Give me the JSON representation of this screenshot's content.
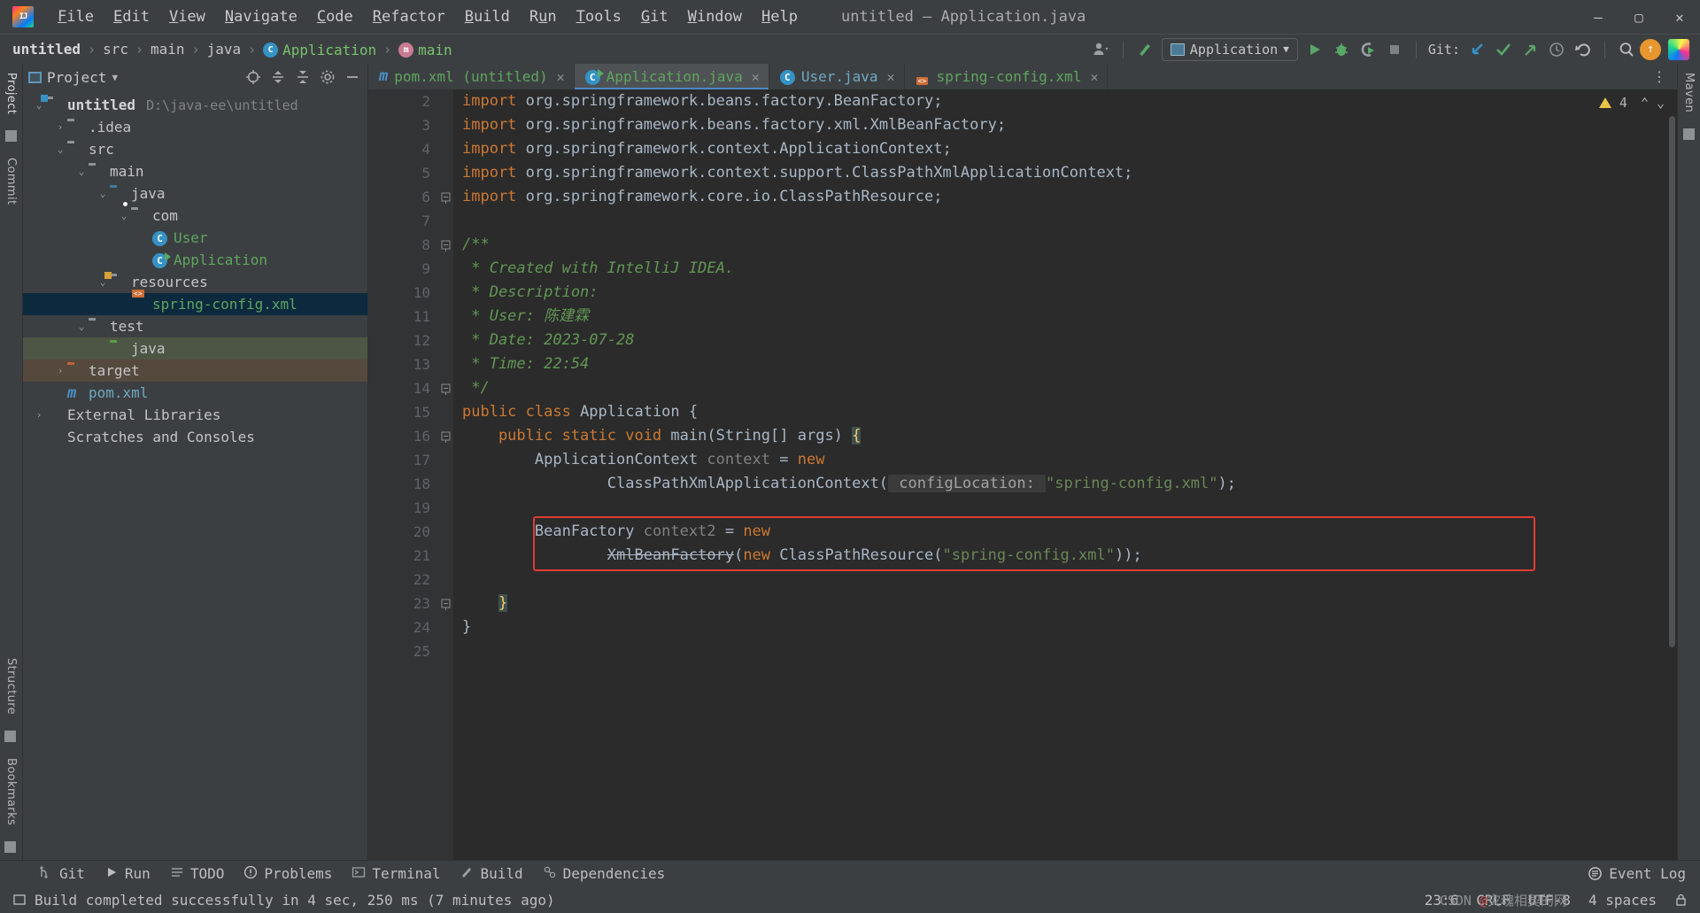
{
  "window": {
    "title": "untitled – Application.java",
    "logo_text": "IJ",
    "minimize": "—",
    "maximize": "▢",
    "close": "✕"
  },
  "menubar": [
    {
      "pre": "",
      "mn": "F",
      "post": "ile"
    },
    {
      "pre": "",
      "mn": "E",
      "post": "dit"
    },
    {
      "pre": "",
      "mn": "V",
      "post": "iew"
    },
    {
      "pre": "",
      "mn": "N",
      "post": "avigate"
    },
    {
      "pre": "",
      "mn": "C",
      "post": "ode"
    },
    {
      "pre": "",
      "mn": "R",
      "post": "efactor"
    },
    {
      "pre": "",
      "mn": "B",
      "post": "uild"
    },
    {
      "pre": "R",
      "mn": "u",
      "post": "n"
    },
    {
      "pre": "",
      "mn": "T",
      "post": "ools"
    },
    {
      "pre": "",
      "mn": "G",
      "post": "it"
    },
    {
      "pre": "",
      "mn": "W",
      "post": "indow"
    },
    {
      "pre": "",
      "mn": "H",
      "post": "elp"
    }
  ],
  "breadcrumb": [
    {
      "label": "untitled",
      "style": "bold"
    },
    {
      "label": "src",
      "style": "plain"
    },
    {
      "label": "main",
      "style": "plain"
    },
    {
      "label": "java",
      "style": "plain"
    },
    {
      "label": "Application",
      "style": "green",
      "icon": "class-icon"
    },
    {
      "label": "main",
      "style": "green",
      "icon": "method-icon"
    }
  ],
  "toolbar": {
    "run_config": "Application",
    "git_label": "Git:",
    "icons": {
      "user_settings": "user-settings-icon",
      "build_hammer": "build-icon",
      "run": "run-icon",
      "debug": "debug-icon",
      "run_coverage": "run-with-coverage-icon",
      "stop": "stop-icon",
      "git_update": "git-update-icon",
      "git_commit": "git-commit-icon",
      "git_push": "git-push-icon",
      "git_history": "history-icon",
      "rollback": "rollback-icon",
      "search_everywhere": "search-icon",
      "updates_badge": "↑",
      "ide_avatar": "ide-avatar-icon"
    }
  },
  "left_rail": [
    "Project",
    "Commit",
    "Structure",
    "Bookmarks"
  ],
  "right_rail": [
    "Maven"
  ],
  "project_panel": {
    "title": "Project",
    "tree": [
      {
        "depth": 0,
        "arrow": "⌄",
        "icon": "module-folder",
        "label": "untitled",
        "style": "bold",
        "path": "D:\\java-ee\\untitled"
      },
      {
        "depth": 1,
        "arrow": "›",
        "icon": "folder",
        "label": ".idea",
        "style": "plain"
      },
      {
        "depth": 1,
        "arrow": "⌄",
        "icon": "folder",
        "label": "src",
        "style": "plain"
      },
      {
        "depth": 2,
        "arrow": "⌄",
        "icon": "folder",
        "label": "main",
        "style": "plain"
      },
      {
        "depth": 3,
        "arrow": "⌄",
        "icon": "folder-source",
        "label": "java",
        "style": "plain"
      },
      {
        "depth": 4,
        "arrow": "⌄",
        "icon": "package",
        "label": "com",
        "style": "plain"
      },
      {
        "depth": 5,
        "arrow": "",
        "icon": "class",
        "label": "User",
        "style": "green"
      },
      {
        "depth": 5,
        "arrow": "",
        "icon": "class-runnable",
        "label": "Application",
        "style": "green"
      },
      {
        "depth": 3,
        "arrow": "⌄",
        "icon": "folder-resources",
        "label": "resources",
        "style": "plain"
      },
      {
        "depth": 4,
        "arrow": "",
        "icon": "xml",
        "label": "spring-config.xml",
        "style": "green",
        "selected": true
      },
      {
        "depth": 2,
        "arrow": "⌄",
        "icon": "folder",
        "label": "test",
        "style": "plain"
      },
      {
        "depth": 3,
        "arrow": "",
        "icon": "folder-test",
        "label": "java",
        "style": "plain",
        "tint": "green"
      },
      {
        "depth": 1,
        "arrow": "›",
        "icon": "folder-excluded",
        "label": "target",
        "style": "plain",
        "tint": "brown"
      },
      {
        "depth": 1,
        "arrow": "",
        "icon": "maven",
        "label": "pom.xml",
        "style": "blue"
      },
      {
        "depth": 0,
        "arrow": "›",
        "icon": "library",
        "label": "External Libraries",
        "style": "plain"
      },
      {
        "depth": 0,
        "arrow": "",
        "icon": "scratch",
        "label": "Scratches and Consoles",
        "style": "plain"
      }
    ]
  },
  "editor": {
    "tabs": [
      {
        "label": "pom.xml (untitled)",
        "icon": "maven-icon",
        "color": "green",
        "active": false
      },
      {
        "label": "Application.java",
        "icon": "class-runnable-icon",
        "color": "green",
        "active": true
      },
      {
        "label": "User.java",
        "icon": "class-icon",
        "color": "blue",
        "active": false
      },
      {
        "label": "spring-config.xml",
        "icon": "xml-icon",
        "color": "green",
        "active": false
      }
    ],
    "warning_count": "4",
    "first_line_number": 2,
    "lines": [
      {
        "n": 2,
        "segments": [
          {
            "t": "import ",
            "c": "kw"
          },
          {
            "t": "org.springframework.beans.factory.BeanFactory;",
            "c": "id"
          }
        ]
      },
      {
        "n": 3,
        "segments": [
          {
            "t": "import ",
            "c": "kw"
          },
          {
            "t": "org.springframework.beans.factory.xml.XmlBeanFactory;",
            "c": "id"
          }
        ]
      },
      {
        "n": 4,
        "segments": [
          {
            "t": "import ",
            "c": "kw"
          },
          {
            "t": "org.springframework.context.ApplicationContext;",
            "c": "id"
          }
        ]
      },
      {
        "n": 5,
        "segments": [
          {
            "t": "import ",
            "c": "kw"
          },
          {
            "t": "org.springframework.context.support.ClassPathXmlApplicationContext;",
            "c": "id"
          }
        ]
      },
      {
        "n": 6,
        "segments": [
          {
            "t": "import ",
            "c": "kw"
          },
          {
            "t": "org.springframework.core.io.ClassPathResource;",
            "c": "id"
          }
        ],
        "fold": "minus"
      },
      {
        "n": 7,
        "segments": []
      },
      {
        "n": 8,
        "segments": [
          {
            "t": "/**",
            "c": "cmt"
          }
        ],
        "fold": "minus"
      },
      {
        "n": 9,
        "segments": [
          {
            "t": " * Created with IntelliJ IDEA.",
            "c": "cmt"
          }
        ]
      },
      {
        "n": 10,
        "segments": [
          {
            "t": " * Description:",
            "c": "cmt"
          }
        ]
      },
      {
        "n": 11,
        "segments": [
          {
            "t": " * User: 陈建霖",
            "c": "cmt"
          }
        ]
      },
      {
        "n": 12,
        "segments": [
          {
            "t": " * Date: 2023-07-28",
            "c": "cmt"
          }
        ]
      },
      {
        "n": 13,
        "segments": [
          {
            "t": " * Time: 22:54",
            "c": "cmt"
          }
        ]
      },
      {
        "n": 14,
        "segments": [
          {
            "t": " */",
            "c": "cmt"
          }
        ],
        "fold": "minus"
      },
      {
        "n": 15,
        "segments": [
          {
            "t": "public class ",
            "c": "kw"
          },
          {
            "t": "Application ",
            "c": "id"
          },
          {
            "t": "{",
            "c": "id"
          }
        ],
        "run": true
      },
      {
        "n": 16,
        "segments": [
          {
            "t": "    public static void ",
            "c": "kw"
          },
          {
            "t": "main",
            "c": "mth"
          },
          {
            "t": "(",
            "c": "id"
          },
          {
            "t": "String",
            "c": "typ2"
          },
          {
            "t": "[] args) ",
            "c": "id"
          },
          {
            "t": "{",
            "c": "brace"
          }
        ],
        "run": true,
        "fold": "minus"
      },
      {
        "n": 17,
        "segments": [
          {
            "t": "        ApplicationContext ",
            "c": "id"
          },
          {
            "t": "context ",
            "c": "gray"
          },
          {
            "t": "= ",
            "c": "id"
          },
          {
            "t": "new",
            "c": "kw"
          }
        ]
      },
      {
        "n": 18,
        "segments": [
          {
            "t": "                ClassPathXmlApplicationContext(",
            "c": "id"
          },
          {
            "t": " configLocation: ",
            "c": "hint"
          },
          {
            "t": "\"spring-config.xml\"",
            "c": "str"
          },
          {
            "t": ");",
            "c": "id"
          }
        ]
      },
      {
        "n": 19,
        "segments": []
      },
      {
        "n": 20,
        "segments": [
          {
            "t": "        BeanFactory ",
            "c": "id"
          },
          {
            "t": "context2 ",
            "c": "gray"
          },
          {
            "t": "= ",
            "c": "id"
          },
          {
            "t": "new",
            "c": "kw"
          }
        ]
      },
      {
        "n": 21,
        "segments": [
          {
            "t": "                ",
            "c": "id"
          },
          {
            "t": "XmlBeanFactory",
            "c": "strike"
          },
          {
            "t": "(",
            "c": "id"
          },
          {
            "t": "new ",
            "c": "kw"
          },
          {
            "t": "ClassPathResource(",
            "c": "id"
          },
          {
            "t": "\"spring-config.xml\"",
            "c": "str"
          },
          {
            "t": "));",
            "c": "id"
          }
        ]
      },
      {
        "n": 22,
        "segments": []
      },
      {
        "n": 23,
        "segments": [
          {
            "t": "    ",
            "c": "id"
          },
          {
            "t": "}",
            "c": "brace"
          }
        ],
        "fold": "minus"
      },
      {
        "n": 24,
        "segments": [
          {
            "t": "}",
            "c": "id"
          }
        ]
      },
      {
        "n": 25,
        "segments": []
      }
    ],
    "highlight_box": {
      "from_line": 20,
      "to_line": 21,
      "color": "#e03b36"
    }
  },
  "tool_windows": [
    {
      "label": "Git",
      "icon": "git-icon"
    },
    {
      "label": "Run",
      "icon": "run-icon"
    },
    {
      "label": "TODO",
      "icon": "todo-icon"
    },
    {
      "label": "Problems",
      "icon": "problems-icon"
    },
    {
      "label": "Terminal",
      "icon": "terminal-icon"
    },
    {
      "label": "Build",
      "icon": "build-icon"
    },
    {
      "label": "Dependencies",
      "icon": "dependencies-icon"
    }
  ],
  "event_log": "Event Log",
  "statusbar": {
    "message": "Build completed successfully in 4 sec, 250 ms (7 minutes ago)",
    "caret": "23:6",
    "line_sep": "CRLF",
    "encoding": "UTF-8",
    "indent": "4 spaces",
    "lock_icon": "lock-icon"
  },
  "watermark": {
    "prefix": "CSDN ",
    "at": "@",
    "name": "灾魂相契的网"
  }
}
